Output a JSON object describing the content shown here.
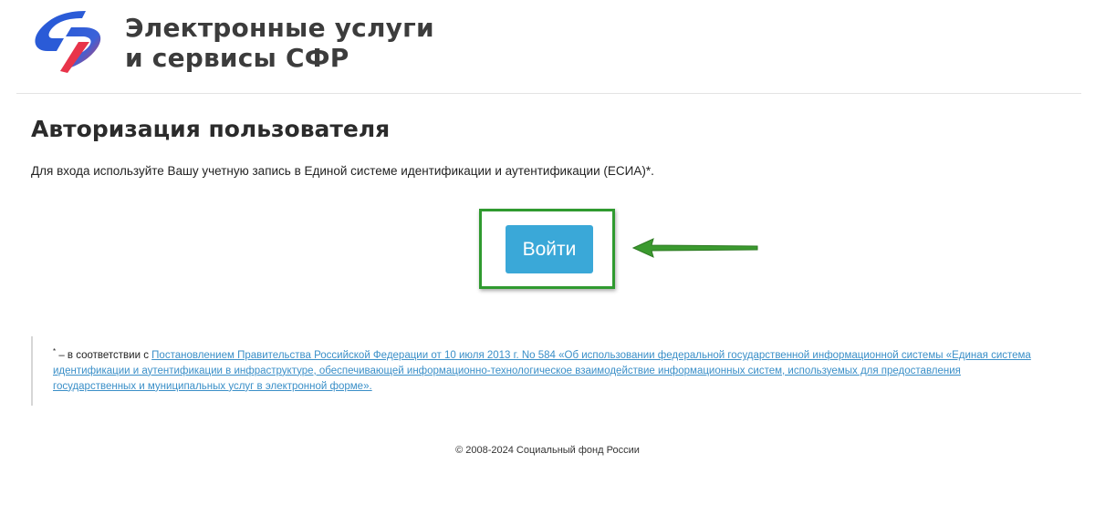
{
  "header": {
    "brand_line1": "Электронные услуги",
    "brand_line2": "и сервисы СФР",
    "logo_icon": "sfr-logo-icon",
    "logo_colors": {
      "blue": "#2a5bd7",
      "red": "#e8344a"
    }
  },
  "main": {
    "title": "Авторизация пользователя",
    "intro": "Для входа используйте Вашу учетную запись в Единой системе идентификации и аутентификации (ЕСИА)*.",
    "login_button_label": "Войти",
    "button_color": "#3aa8d8",
    "highlight_color": "#2f9a2f",
    "arrow_icon": "left-arrow-icon"
  },
  "footnote": {
    "marker": "*",
    "prefix": " – в соответствии с ",
    "link_text": "Постановлением Правительства Российской Федерации от 10 июля 2013 г. No 584 «Об использовании федеральной государственной информационной системы «Единая система идентификации и аутентификации в инфраструктуре, обеспечивающей информационно-технологическое взаимодействие информационных систем, используемых для предоставления государственных и муниципальных услуг в электронной форме»."
  },
  "footer": {
    "copyright": "© 2008-2024 Социальный фонд России"
  }
}
